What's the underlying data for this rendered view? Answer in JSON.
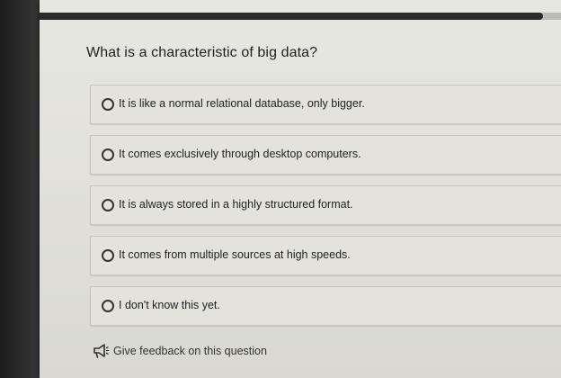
{
  "progress": {
    "fraction": 0.965
  },
  "question": {
    "text": "What is a characteristic of big data?"
  },
  "options": [
    {
      "label": "It is like a normal relational database, only bigger."
    },
    {
      "label": "It comes exclusively through desktop computers."
    },
    {
      "label": "It is always stored in a highly structured format."
    },
    {
      "label": "It comes from multiple sources at high speeds."
    },
    {
      "label": "I don't know this yet."
    }
  ],
  "feedback": {
    "label": "Give feedback on this question",
    "icon": "megaphone-icon"
  },
  "colors": {
    "panel_background": "#e3e3dc",
    "progress_fill": "#2b2b2b",
    "text": "#1f1f1f"
  }
}
